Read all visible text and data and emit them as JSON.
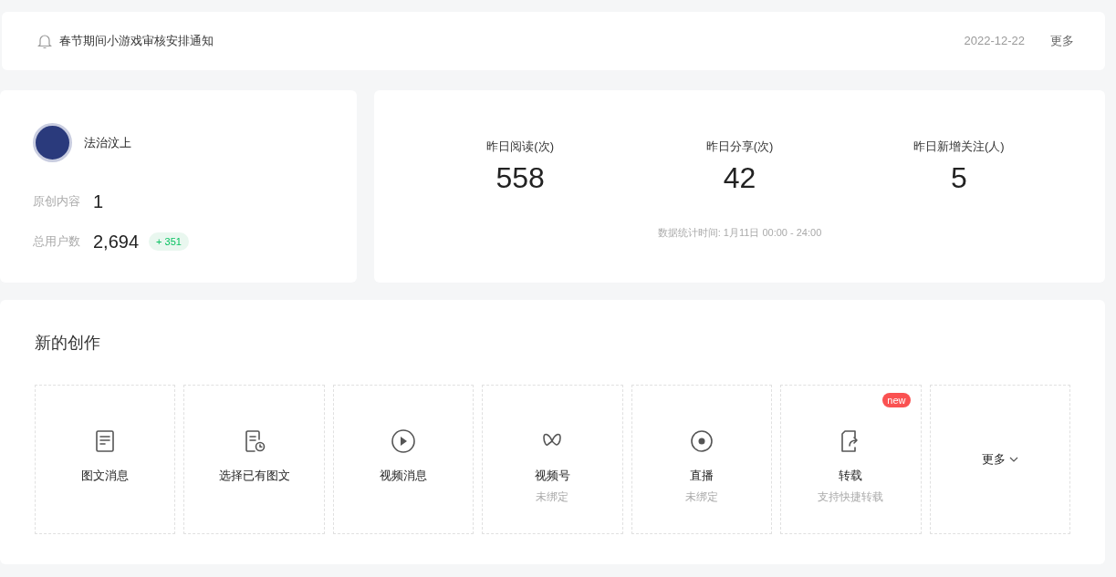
{
  "notice": {
    "title": "春节期间小游戏审核安排通知",
    "date": "2022-12-22",
    "more": "更多"
  },
  "account": {
    "name": "法治汶上",
    "stats": [
      {
        "label": "原创内容",
        "value": "1"
      },
      {
        "label": "总用户数",
        "value": "2,694",
        "delta": "+ 351"
      }
    ]
  },
  "yesterday": {
    "metrics": [
      {
        "label": "昨日阅读(次)",
        "value": "558"
      },
      {
        "label": "昨日分享(次)",
        "value": "42"
      },
      {
        "label": "昨日新增关注(人)",
        "value": "5"
      }
    ],
    "note": "数据统计时间: 1月11日 00:00 - 24:00"
  },
  "create": {
    "title": "新的创作",
    "items": [
      {
        "kind": "article",
        "label": "图文消息"
      },
      {
        "kind": "existing",
        "label": "选择已有图文"
      },
      {
        "kind": "video",
        "label": "视频消息"
      },
      {
        "kind": "channels",
        "label": "视频号",
        "sub": "未绑定"
      },
      {
        "kind": "live",
        "label": "直播",
        "sub": "未绑定"
      },
      {
        "kind": "repost",
        "label": "转载",
        "sub": "支持快捷转载",
        "badge": "new"
      }
    ],
    "more": "更多"
  }
}
